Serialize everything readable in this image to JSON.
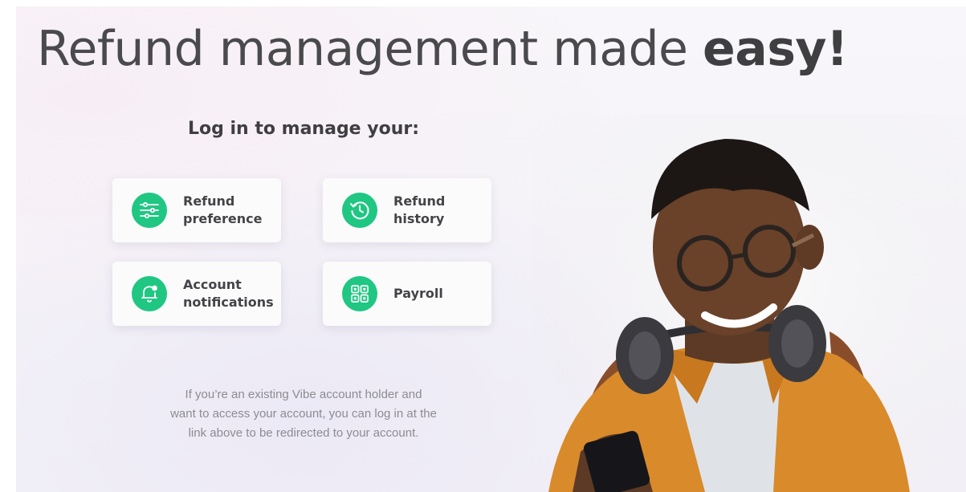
{
  "hero": {
    "headline_regular": "Refund management made ",
    "headline_bold": "easy!",
    "subheading": "Log in to manage your:"
  },
  "features": [
    {
      "line1": "Refund",
      "line2": "preference",
      "icon": "sliders-icon"
    },
    {
      "line1": "Refund",
      "line2": "history",
      "icon": "history-clock-icon"
    },
    {
      "line1": "Account",
      "line2": "notifications",
      "icon": "bell-icon"
    },
    {
      "line1": "Payroll",
      "line2": "",
      "icon": "qr-grid-icon"
    }
  ],
  "note": {
    "line1": "If you’re an existing Vibe account holder and",
    "line2": "want to access your account, you can log in at the",
    "line3": "link above to be redirected to your account."
  },
  "colors": {
    "accent": "#1fc782",
    "heading": "#4a4a4d",
    "note_text": "#8c8c92"
  }
}
